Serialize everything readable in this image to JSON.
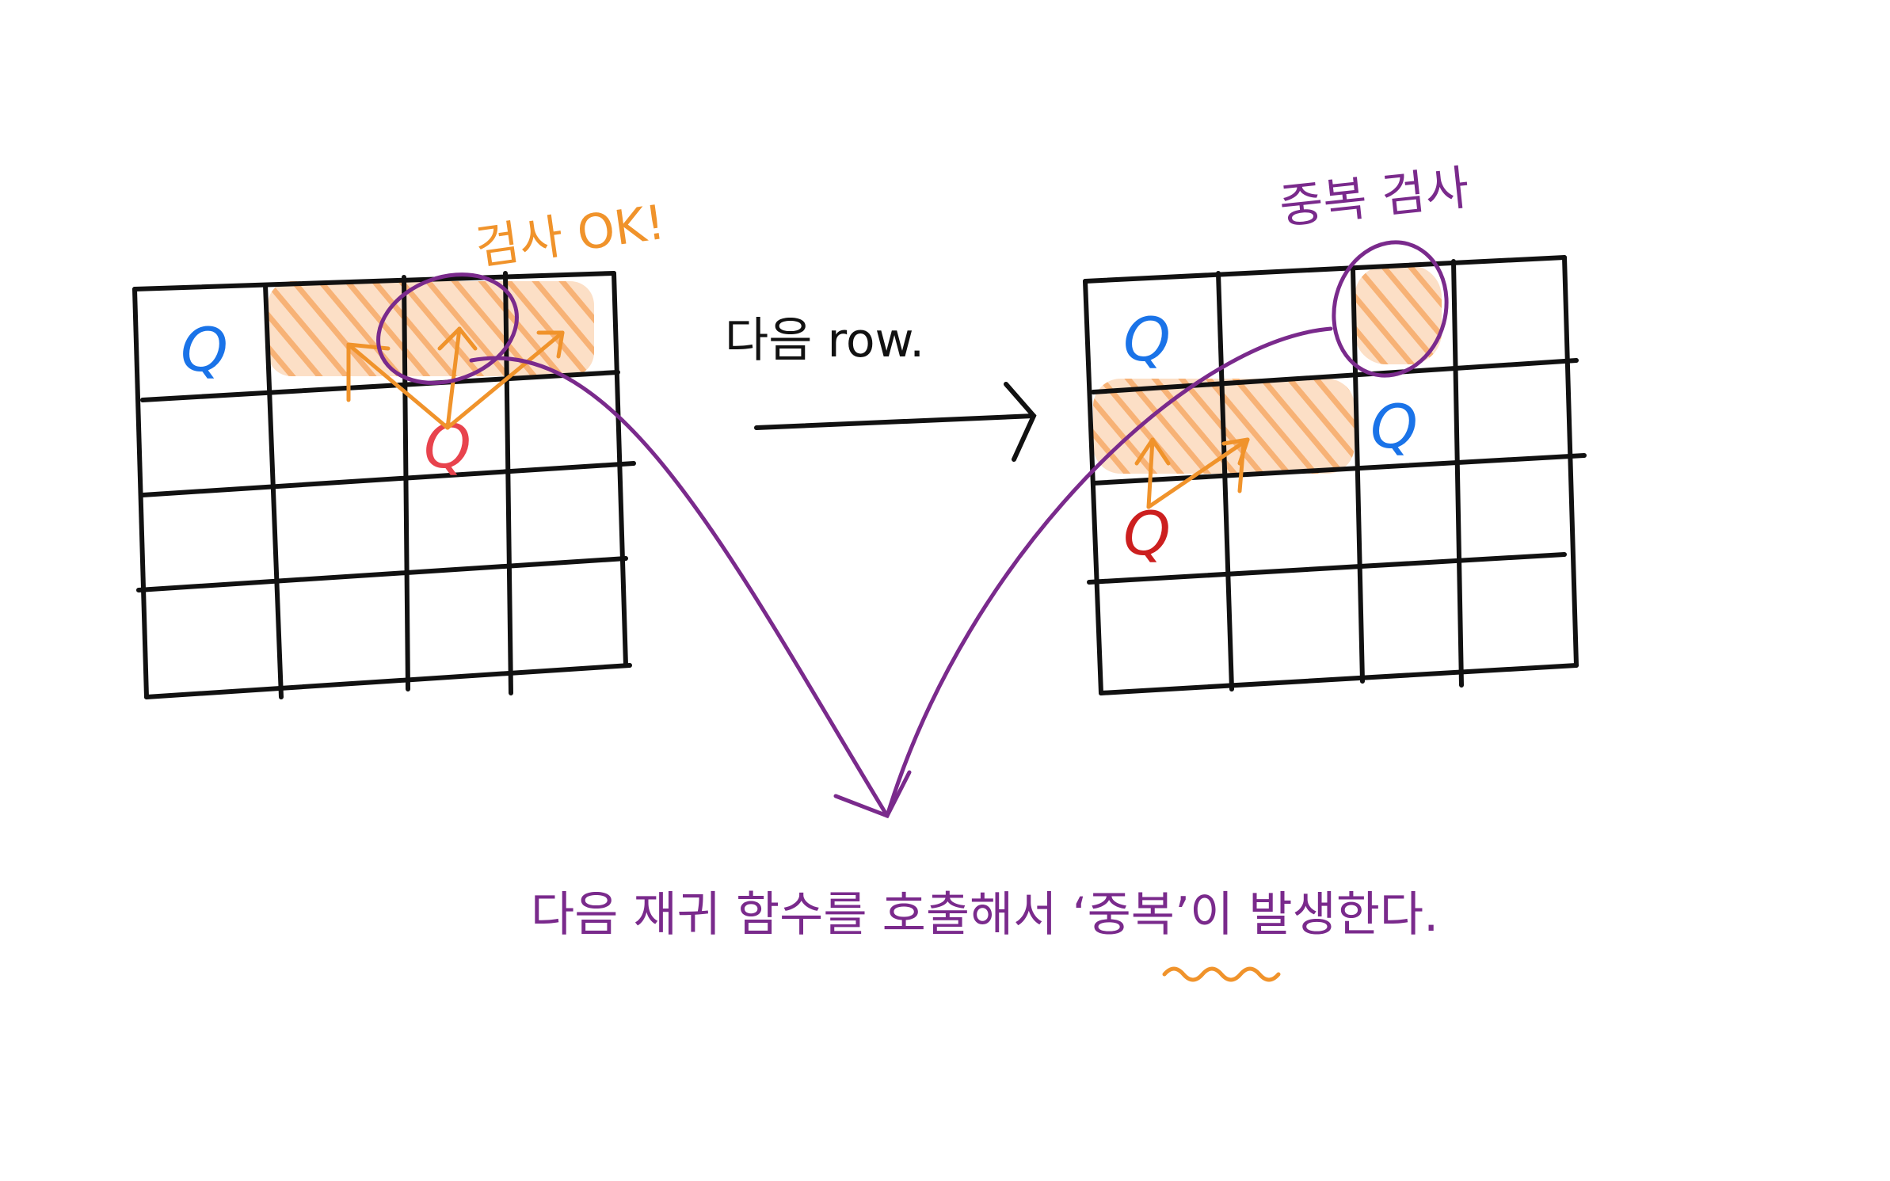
{
  "labels": {
    "check_ok": "검사 OK!",
    "duplicate_check": "중복 검사",
    "next_row": "다음 row.",
    "caption_part1": "다음 재귀 함수를 호출해서 ‘",
    "caption_keyword": "중복",
    "caption_part2": "’이 발생한다."
  },
  "queen_symbol": "Q",
  "colors": {
    "grid": "#111111",
    "highlight": "#f5a35a",
    "arrow_orange": "#f0932b",
    "annotation_purple": "#7a2a8c",
    "queen_placed": "#1a73e8",
    "queen_new_left": "#e8434d",
    "queen_new_right": "#cc1f1f"
  },
  "boards": [
    {
      "name": "left",
      "size": 4,
      "placed_queens": [
        {
          "row": 0,
          "col": 0
        }
      ],
      "new_queen": {
        "row": 1,
        "col": 2
      },
      "highlighted_row": 0,
      "circled_cell": {
        "row": 0,
        "col": 2
      }
    },
    {
      "name": "right",
      "size": 4,
      "placed_queens": [
        {
          "row": 0,
          "col": 0
        },
        {
          "row": 1,
          "col": 2
        }
      ],
      "new_queen": {
        "row": 2,
        "col": 0
      },
      "highlighted_row": 1,
      "circled_cell": {
        "row": 0,
        "col": 2
      }
    }
  ]
}
